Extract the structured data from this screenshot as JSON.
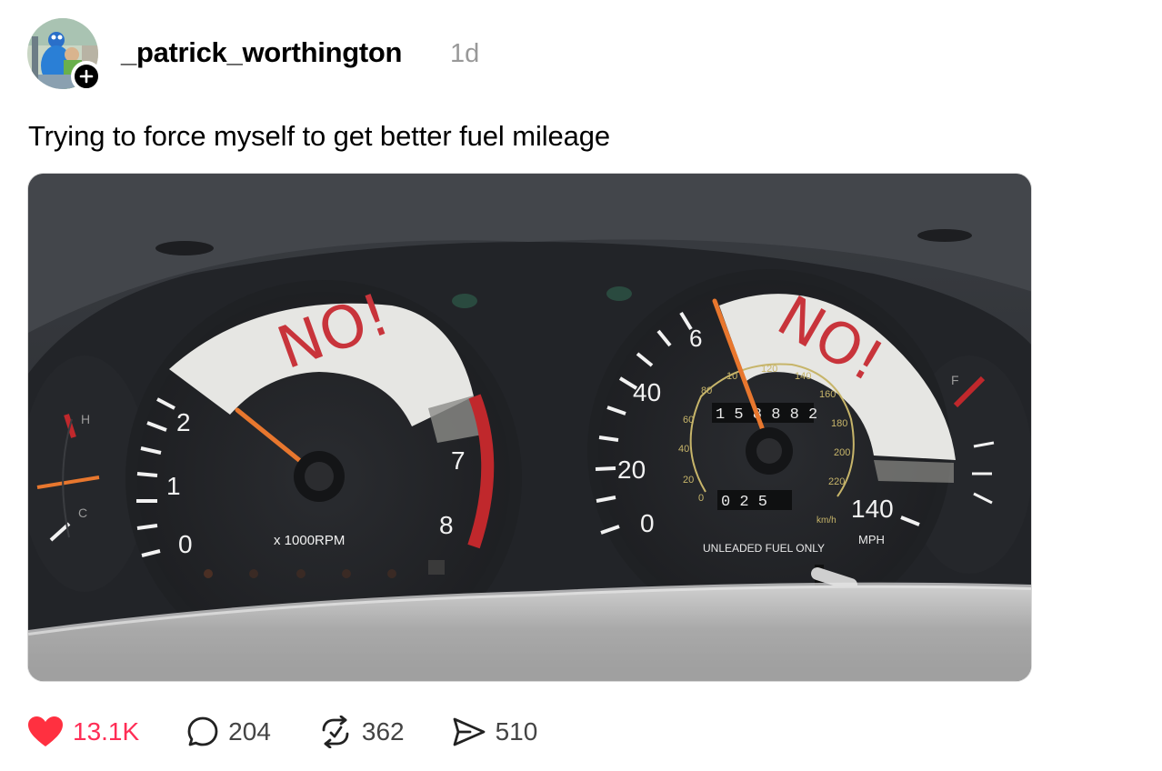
{
  "post": {
    "username": "_patrick_worthington",
    "timestamp": "1d",
    "caption": "Trying to force myself to get better fuel mileage"
  },
  "photo": {
    "tachometer": {
      "sign_text": "NO!",
      "numbers": [
        "0",
        "1",
        "2",
        "7",
        "8"
      ],
      "unit_label": "x 1000RPM"
    },
    "speedometer": {
      "sign_text": "NO!",
      "mph_numbers": [
        "0",
        "20",
        "40",
        "6",
        "140"
      ],
      "kmh_numbers": [
        "0",
        "20",
        "40",
        "60",
        "80",
        "10",
        "120",
        "140",
        "160",
        "180",
        "200",
        "220"
      ],
      "odometer": "1 5 8 8 8 2",
      "trip": "0 2 5",
      "kmh_label": "km/h",
      "mph_label": "MPH",
      "fuel_label": "UNLEADED FUEL ONLY"
    },
    "temp_gauge": {
      "hot": "H",
      "cold": "C"
    },
    "fuel_gauge": {
      "full": "F"
    }
  },
  "actions": {
    "likes": "13.1K",
    "comments": "204",
    "reposts": "362",
    "shares": "510"
  },
  "colors": {
    "like": "#ff3040",
    "timestamp": "#999999",
    "needle": "#e8772e",
    "marker": "#c8343b"
  }
}
